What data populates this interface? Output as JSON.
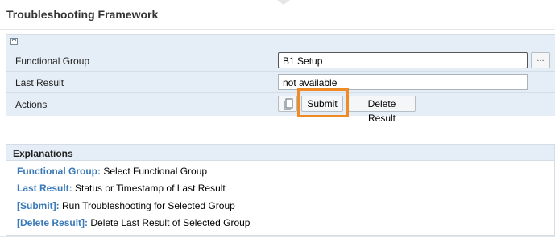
{
  "header": {
    "title": "Troubleshooting Framework"
  },
  "form": {
    "functional_group": {
      "label": "Functional Group",
      "value": "B1 Setup",
      "value_help": "..."
    },
    "last_result": {
      "label": "Last Result",
      "value": "not available"
    },
    "actions": {
      "label": "Actions",
      "submit_label": "Submit",
      "delete_label": "Delete Result"
    }
  },
  "explanations": {
    "title": "Explanations",
    "items": [
      {
        "key": "Functional Group:",
        "text": " Select Functional Group"
      },
      {
        "key": "Last Result:",
        "text": " Status or Timestamp of Last Result"
      },
      {
        "key": "[Submit]:",
        "text": " Run Troubleshooting for Selected Group"
      },
      {
        "key": "[Delete Result]:",
        "text": " Delete Last Result of Selected Group"
      }
    ]
  },
  "colors": {
    "accent_link": "#3a7ab8",
    "highlight": "#f08a24",
    "panel_bg": "#e5eef6"
  }
}
